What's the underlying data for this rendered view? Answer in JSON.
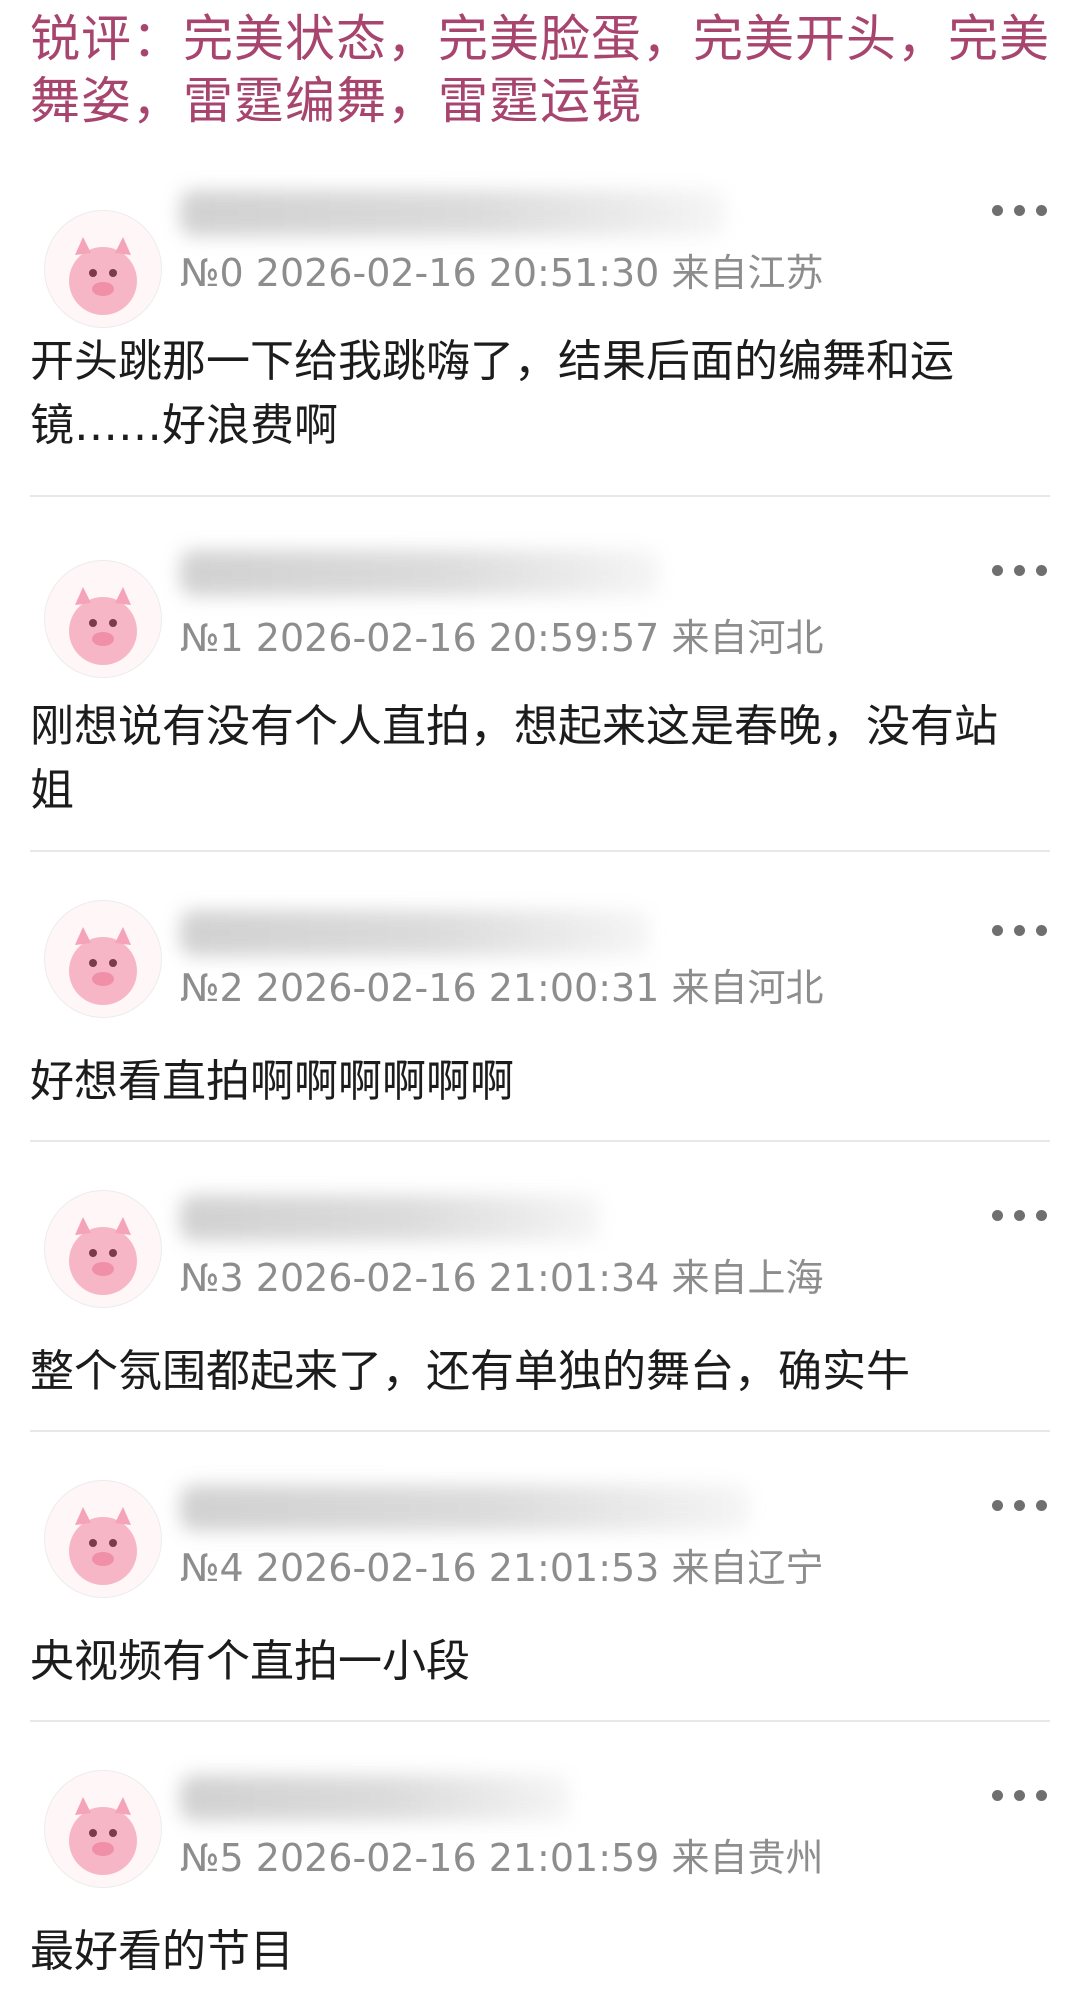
{
  "header": {
    "text": "锐评：完美状态，完美脸蛋，完美开头，完美舞姿，雷霆编舞，雷霆运镜"
  },
  "comments": [
    {
      "meta": "№0 2026-02-16 20:51:30 来自江苏",
      "text": "开头跳那一下给我跳嗨了，结果后面的编舞和运镜……好浪费啊"
    },
    {
      "meta": "№1 2026-02-16 20:59:57 来自河北",
      "text": "刚想说有没有个人直拍，想起来这是春晚，没有站姐"
    },
    {
      "meta": "№2 2026-02-16 21:00:31 来自河北",
      "text": "好想看直拍啊啊啊啊啊啊"
    },
    {
      "meta": "№3 2026-02-16 21:01:34 来自上海",
      "text": "整个氛围都起来了，还有单独的舞台，确实牛"
    },
    {
      "meta": "№4 2026-02-16 21:01:53 来自辽宁",
      "text": "央视频有个直拍一小段"
    },
    {
      "meta": "№5 2026-02-16 21:01:59 来自贵州",
      "text": "最好看的节目"
    }
  ],
  "icons": {
    "avatar": "pink-pig-avatar-icon",
    "more": "more-dots-icon"
  },
  "colors": {
    "header": "#a8456f",
    "meta": "#8d8d8d",
    "text": "#1c1c1c",
    "divider": "#e8e8e8"
  }
}
